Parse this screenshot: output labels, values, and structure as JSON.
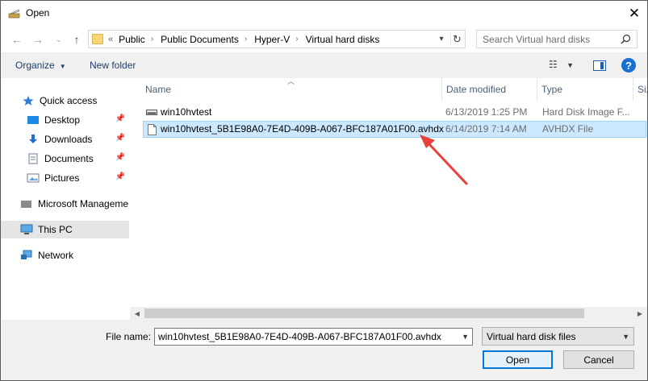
{
  "window": {
    "title": "Open",
    "close_glyph": "✕"
  },
  "nav": {
    "back_icon": "back-arrow-icon",
    "forward_icon": "forward-arrow-icon",
    "up_icon": "up-arrow-icon",
    "breadcrumb_overflow": "«",
    "breadcrumbs": [
      "Public",
      "Public Documents",
      "Hyper-V",
      "Virtual hard disks"
    ],
    "search_placeholder": "Search Virtual hard disks"
  },
  "toolbar": {
    "organize_label": "Organize",
    "new_folder_label": "New folder",
    "help_glyph": "?"
  },
  "sidebar": {
    "items": [
      {
        "label": "Quick access",
        "icon": "star-icon",
        "pinned": false
      },
      {
        "label": "Desktop",
        "icon": "desktop-folder-icon",
        "pinned": true
      },
      {
        "label": "Downloads",
        "icon": "download-arrow-icon",
        "pinned": true
      },
      {
        "label": "Documents",
        "icon": "document-folder-icon",
        "pinned": true
      },
      {
        "label": "Pictures",
        "icon": "pictures-folder-icon",
        "pinned": true
      },
      {
        "label": "Microsoft Manageme",
        "icon": "cloud-icon",
        "pinned": false
      },
      {
        "label": "This PC",
        "icon": "computer-icon",
        "pinned": false
      },
      {
        "label": "Network",
        "icon": "network-icon",
        "pinned": false
      }
    ]
  },
  "list": {
    "columns": [
      "Name",
      "Date modified",
      "Type",
      "Size"
    ],
    "column_size_visible": "Siz",
    "rows": [
      {
        "name": "win10hvtest",
        "date": "6/13/2019 1:25 PM",
        "type": "Hard Disk Image F...",
        "icon": "hard-disk-icon",
        "selected": false
      },
      {
        "name": "win10hvtest_5B1E98A0-7E4D-409B-A067-BFC187A01F00.avhdx",
        "date": "6/14/2019 7:14 AM",
        "type": "AVHDX File",
        "icon": "blank-file-icon",
        "selected": true
      }
    ]
  },
  "footer": {
    "filename_label": "File name:",
    "filename_value": "win10hvtest_5B1E98A0-7E4D-409B-A067-BFC187A01F00.avhdx",
    "filetype_value": "Virtual hard disk files",
    "open_label": "Open",
    "cancel_label": "Cancel"
  },
  "colors": {
    "selection": "#cce8ff",
    "accent": "#0078d7",
    "annotation_arrow": "#e8413c"
  }
}
